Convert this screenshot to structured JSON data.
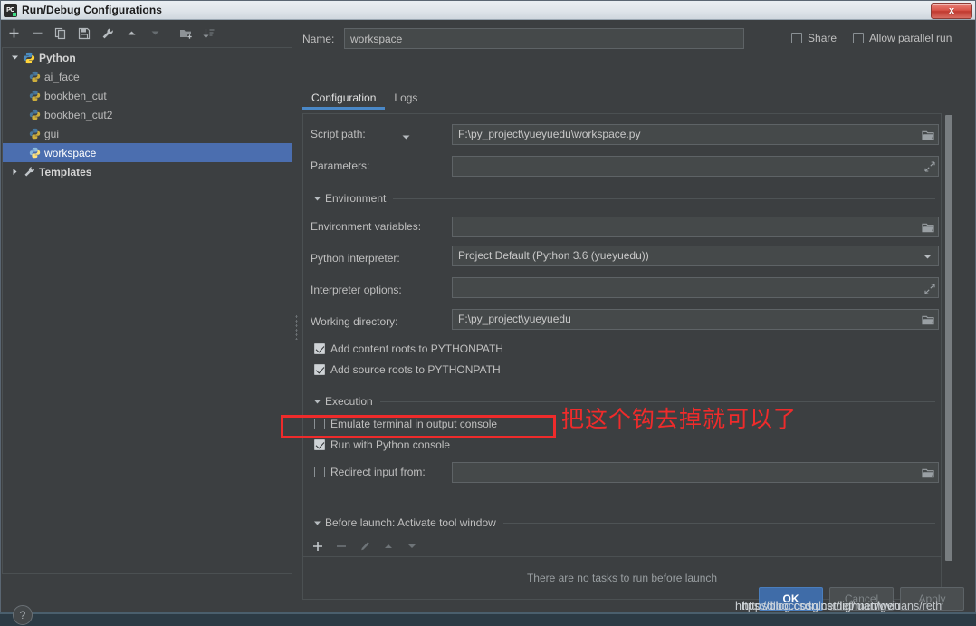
{
  "window": {
    "title": "Run/Debug Configurations",
    "app_icon": "pycharm-icon",
    "close_label": "x"
  },
  "left_toolbar": {
    "buttons": [
      {
        "name": "add-configuration-button",
        "icon": "plus-icon"
      },
      {
        "name": "remove-configuration-button",
        "icon": "minus-icon"
      },
      {
        "name": "copy-configuration-button",
        "icon": "copy-icon"
      },
      {
        "name": "save-configuration-button",
        "icon": "save-icon"
      },
      {
        "name": "edit-templates-button",
        "icon": "wrench-icon"
      },
      {
        "name": "move-up-button",
        "icon": "arrow-up-icon"
      },
      {
        "name": "move-down-button",
        "icon": "arrow-down-icon"
      },
      {
        "name": "new-folder-button",
        "icon": "folder-add-icon"
      },
      {
        "name": "sort-configurations-button",
        "icon": "sort-icon"
      }
    ]
  },
  "tree": {
    "root": {
      "label": "Python",
      "icon": "python-icon",
      "expanded": true
    },
    "children": [
      {
        "label": "ai_face",
        "icon": "python-file-icon",
        "selected": false
      },
      {
        "label": "bookben_cut",
        "icon": "python-file-icon",
        "selected": false
      },
      {
        "label": "bookben_cut2",
        "icon": "python-file-icon",
        "selected": false
      },
      {
        "label": "gui",
        "icon": "python-file-icon",
        "selected": false
      },
      {
        "label": "workspace",
        "icon": "python-file-icon",
        "selected": true
      }
    ],
    "templates": {
      "label": "Templates",
      "icon": "wrench-icon",
      "expanded": false
    }
  },
  "help_button": {
    "label": "?"
  },
  "header": {
    "name_label": "Name:",
    "name_value": "workspace",
    "share_label": "Share",
    "share_checked": false,
    "parallel_label": "Allow parallel run",
    "parallel_checked": false
  },
  "tabs": [
    {
      "label": "Configuration",
      "active": true
    },
    {
      "label": "Logs",
      "active": false
    }
  ],
  "form": {
    "script_path": {
      "label": "Script path:",
      "value": "F:\\py_project\\yueyuedu\\workspace.py",
      "browse_icon": "folder-icon",
      "dropdown_icon": "chevron-down-icon"
    },
    "parameters": {
      "label": "Parameters:",
      "value": "",
      "expand_icon": "expand-icon"
    },
    "environment_section": {
      "label": "Environment",
      "expanded": true
    },
    "environment_variables": {
      "label": "Environment variables:",
      "value": "",
      "browse_icon": "folder-icon"
    },
    "python_interpreter": {
      "label": "Python interpreter:",
      "value": "Project Default (Python 3.6 (yueyuedu))",
      "dropdown_icon": "chevron-down-icon"
    },
    "interpreter_options": {
      "label": "Interpreter options:",
      "value": "",
      "expand_icon": "expand-icon"
    },
    "working_directory": {
      "label": "Working directory:",
      "value": "F:\\py_project\\yueyuedu",
      "browse_icon": "folder-icon"
    },
    "add_content_roots": {
      "label": "Add content roots to PYTHONPATH",
      "checked": true
    },
    "add_source_roots": {
      "label": "Add source roots to PYTHONPATH",
      "checked": true
    },
    "execution_section": {
      "label": "Execution",
      "expanded": true
    },
    "emulate_terminal": {
      "label": "Emulate terminal in output console",
      "checked": false
    },
    "run_with_console": {
      "label": "Run with Python console",
      "checked": true
    },
    "redirect_input": {
      "label": "Redirect input from:",
      "checked": false,
      "value": "",
      "browse_icon": "folder-icon"
    }
  },
  "before_launch": {
    "section_label": "Before launch: Activate tool window",
    "expanded": true,
    "toolbar": [
      {
        "name": "add-task-button",
        "icon": "plus-icon"
      },
      {
        "name": "remove-task-button",
        "icon": "minus-icon"
      },
      {
        "name": "edit-task-button",
        "icon": "pencil-icon"
      },
      {
        "name": "move-task-up-button",
        "icon": "arrow-up-icon"
      },
      {
        "name": "move-task-down-button",
        "icon": "arrow-down-icon"
      }
    ],
    "empty_text": "There are no tasks to run before launch"
  },
  "footer": {
    "ok": "OK",
    "cancel": "Cancel",
    "apply": "Apply"
  },
  "annotation": {
    "note": "把这个钩去掉就可以了",
    "color": "#ef2b2b",
    "highlight_target": "Run with Python console"
  },
  "watermark": {
    "line_a": "https://blog.csdn.net/lighuan/weh",
    "line_b": "httpsdlbocdosglcsrdet/metrlgviuans/reth"
  },
  "colors": {
    "dialog_bg": "#3c3f41",
    "field_bg": "#45494a",
    "selection_blue": "#4b6eaf",
    "tab_accent": "#4a88c7",
    "annotation_red": "#ef2b2b",
    "text": "#bfbfbf"
  }
}
